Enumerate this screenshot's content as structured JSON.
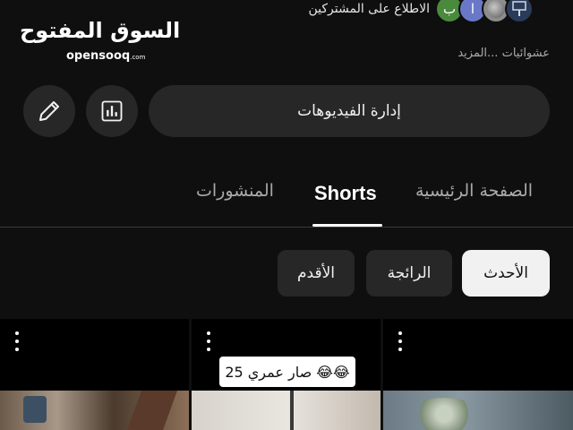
{
  "logo": {
    "arabic": "السوق المفتوح",
    "latin": "opensooq",
    "latin_suffix": ".com"
  },
  "channel": {
    "subscribers_link": "الاطلاع على المشتركين",
    "avatars": [
      {
        "letter": "ب",
        "color": "#4a8a3c"
      },
      {
        "letter": "ا",
        "color": "#6a78c8"
      },
      {
        "letter": "",
        "color": "#8d8d8d"
      },
      {
        "letter": "",
        "color": "#2a3b5a"
      }
    ],
    "description": "عشوائيات ...المزيد"
  },
  "actions": {
    "edit_icon": "pencil-icon",
    "stats_icon": "bar-chart-icon",
    "manage_videos_label": "إدارة الفيديوهات"
  },
  "tabs": [
    {
      "label": "المنشورات",
      "active": false
    },
    {
      "label": "Shorts",
      "active": true
    },
    {
      "label": "الصفحة الرئيسية",
      "active": false
    }
  ],
  "filters": {
    "oldest": "الأقدم",
    "popular": "الرائجة",
    "latest": "الأحدث",
    "selected": "الأحدث"
  },
  "shorts": [
    {
      "caption": ""
    },
    {
      "caption": "صار عمري 25 😂😂"
    },
    {
      "caption": ""
    }
  ],
  "colors": {
    "background": "#0f0f0f",
    "surface": "#272727",
    "chip_selected": "#f1f1f1",
    "text_secondary": "#aaaaaa"
  }
}
